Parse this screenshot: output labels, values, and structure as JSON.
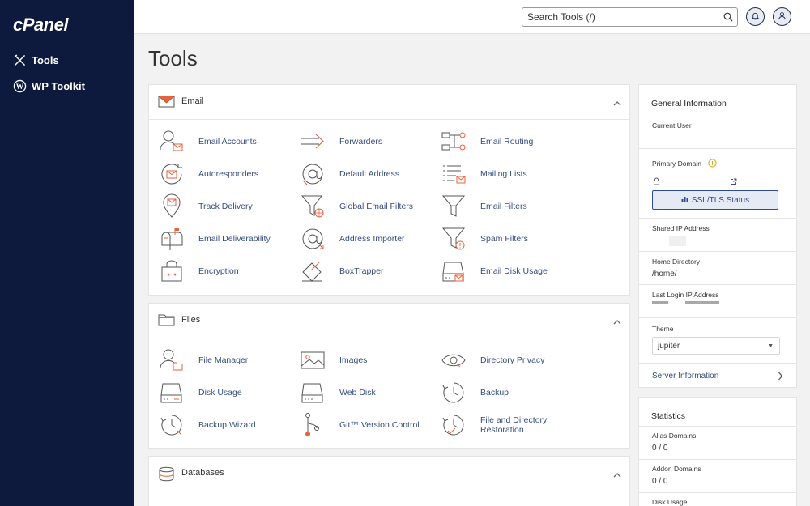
{
  "sidebar": {
    "logo": "cPanel",
    "items": [
      {
        "label": "Tools",
        "icon": "tools-icon"
      },
      {
        "label": "WP Toolkit",
        "icon": "wordpress-icon"
      }
    ]
  },
  "header": {
    "search_placeholder": "Search Tools (/)"
  },
  "page_title": "Tools",
  "sections": {
    "email": {
      "title": "Email",
      "tools": [
        "Email Accounts",
        "Forwarders",
        "Email Routing",
        "Autoresponders",
        "Default Address",
        "Mailing Lists",
        "Track Delivery",
        "Global Email Filters",
        "Email Filters",
        "Email Deliverability",
        "Address Importer",
        "Spam Filters",
        "Encryption",
        "BoxTrapper",
        "Email Disk Usage"
      ]
    },
    "files": {
      "title": "Files",
      "tools": [
        "File Manager",
        "Images",
        "Directory Privacy",
        "Disk Usage",
        "Web Disk",
        "Backup",
        "Backup Wizard",
        "Git™ Version Control",
        "File and Directory Restoration"
      ]
    },
    "databases": {
      "title": "Databases"
    }
  },
  "general_info": {
    "title": "General Information",
    "current_user_label": "Current User",
    "primary_domain_label": "Primary Domain",
    "ssl_button": "SSL/TLS Status",
    "shared_ip_label": "Shared IP Address",
    "home_dir_label": "Home Directory",
    "home_dir_value": "/home/",
    "last_login_label": "Last Login IP Address",
    "theme_label": "Theme",
    "theme_value": "jupiter",
    "server_info_link": "Server Information"
  },
  "statistics": {
    "title": "Statistics",
    "items": [
      {
        "label": "Alias Domains",
        "value": "0 / 0"
      },
      {
        "label": "Addon Domains",
        "value": "0 / 0"
      },
      {
        "label": "Disk Usage",
        "value": ""
      }
    ]
  },
  "colors": {
    "sidebar_bg": "#0e1a3d",
    "link": "#364d81",
    "accent": "#e8623f"
  }
}
